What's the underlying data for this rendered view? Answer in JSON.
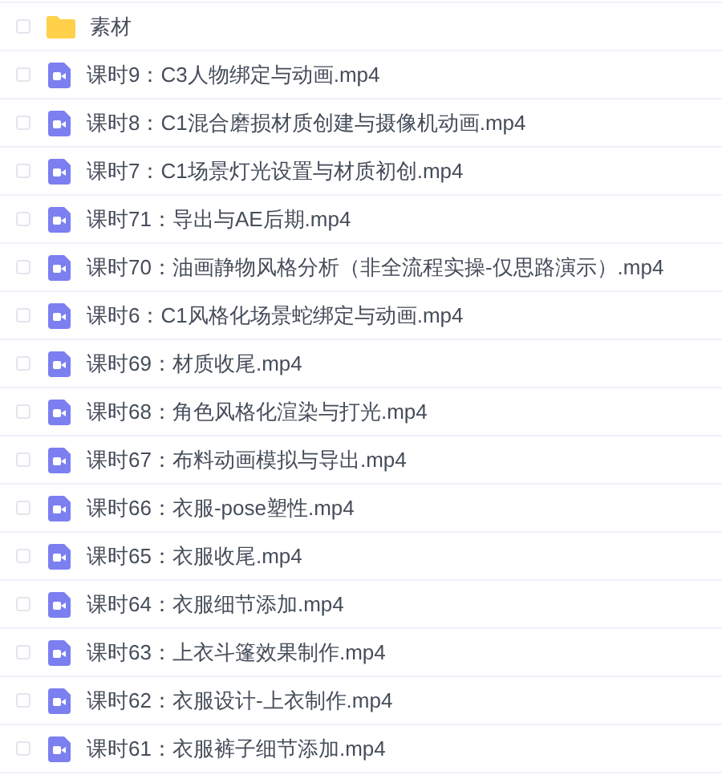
{
  "files": [
    {
      "kind": "folder",
      "name": "素材",
      "checked": false
    },
    {
      "kind": "video",
      "name": "课时9：C3人物绑定与动画.mp4",
      "checked": false
    },
    {
      "kind": "video",
      "name": "课时8：C1混合磨损材质创建与摄像机动画.mp4",
      "checked": false
    },
    {
      "kind": "video",
      "name": "课时7：C1场景灯光设置与材质初创.mp4",
      "checked": false
    },
    {
      "kind": "video",
      "name": "课时71：导出与AE后期.mp4",
      "checked": false
    },
    {
      "kind": "video",
      "name": "课时70：油画静物风格分析（非全流程实操-仅思路演示）.mp4",
      "checked": false
    },
    {
      "kind": "video",
      "name": "课时6：C1风格化场景蛇绑定与动画.mp4",
      "checked": false
    },
    {
      "kind": "video",
      "name": "课时69：材质收尾.mp4",
      "checked": false
    },
    {
      "kind": "video",
      "name": "课时68：角色风格化渲染与打光.mp4",
      "checked": false
    },
    {
      "kind": "video",
      "name": "课时67：布料动画模拟与导出.mp4",
      "checked": false
    },
    {
      "kind": "video",
      "name": "课时66：衣服-pose塑性.mp4",
      "checked": false
    },
    {
      "kind": "video",
      "name": "课时65：衣服收尾.mp4",
      "checked": false
    },
    {
      "kind": "video",
      "name": "课时64：衣服细节添加.mp4",
      "checked": false
    },
    {
      "kind": "video",
      "name": "课时63：上衣斗篷效果制作.mp4",
      "checked": false
    },
    {
      "kind": "video",
      "name": "课时62：衣服设计-上衣制作.mp4",
      "checked": false
    },
    {
      "kind": "video",
      "name": "课时61：衣服裤子细节添加.mp4",
      "checked": false
    }
  ]
}
